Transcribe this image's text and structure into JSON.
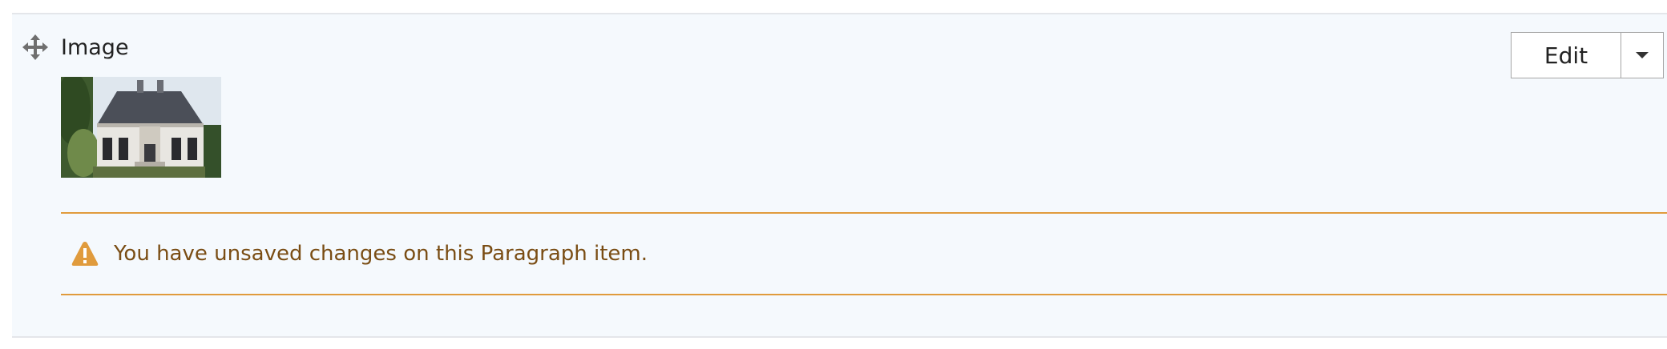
{
  "paragraph": {
    "label": "Image",
    "thumbnail_alt": "Image thumbnail of a historic manor house",
    "edit_label": "Edit",
    "dropdown_icon": "caret-down-icon",
    "drag_icon": "move-icon"
  },
  "warning": {
    "icon": "warning-triangle-icon",
    "message": "You have unsaved changes on this Paragraph item."
  },
  "colors": {
    "row_background": "#f5f9fd",
    "warning_border": "#e09b3d",
    "warning_icon": "#e09b3d",
    "warning_text": "#7a4d14"
  }
}
